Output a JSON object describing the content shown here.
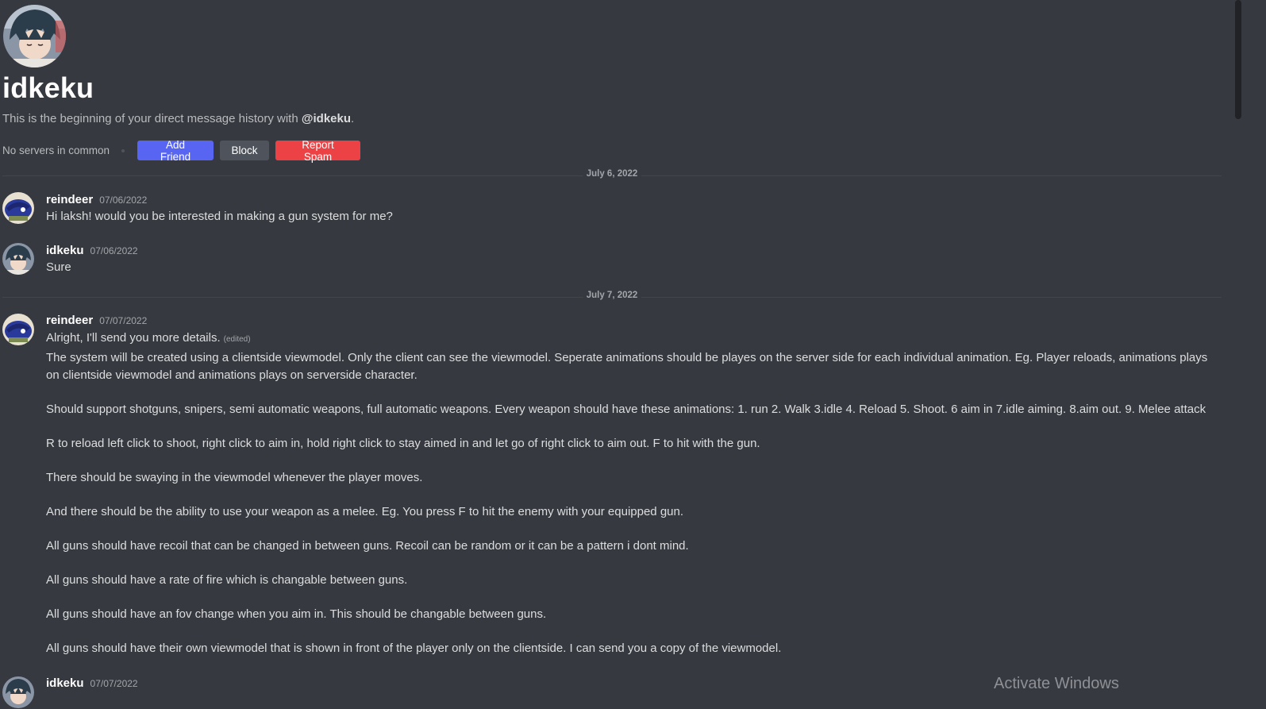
{
  "profile": {
    "name": "idkeku",
    "intro_prefix": "This is the beginning of your direct message history with ",
    "intro_handle": "@idkeku",
    "intro_suffix": ".",
    "servers_text": "No servers in common"
  },
  "actions": {
    "add_friend": "Add Friend",
    "block": "Block",
    "report_spam": "Report Spam"
  },
  "dividers": {
    "first": "July 6, 2022",
    "second": "July 7, 2022"
  },
  "messages": [
    {
      "author": "reindeer",
      "timestamp": "07/06/2022",
      "text": "Hi laksh! would you be interested in making a gun system for me?"
    },
    {
      "author": "idkeku",
      "timestamp": "07/06/2022",
      "text": "Sure"
    },
    {
      "author": "reindeer",
      "timestamp": "07/07/2022",
      "text": "Alright, I'll send you more details.",
      "edited_label": "(edited)",
      "paragraphs": [
        "The system will be created using a clientside viewmodel. Only the client can see the viewmodel. Seperate animations should be playes on the server side for each individual animation. Eg. Player reloads, animations plays on clientside viewmodel and animations plays on serverside character.",
        "Should support shotguns, snipers, semi automatic weapons, full automatic weapons. Every weapon should have these animations: 1. run 2. Walk 3.idle 4. Reload 5. Shoot. 6 aim in 7.idle aiming. 8.aim out. 9. Melee attack",
        "R to reload left click to shoot, right click to aim in, hold right click to stay aimed in and let go of right click to aim out. F to hit with the gun.",
        "There should be swaying in the viewmodel whenever the player moves.",
        "And there should be the ability to use your weapon as a melee. Eg. You press F to hit the enemy with your equipped gun.",
        "All guns should have recoil that can be changed in between guns. Recoil can be random or it can be a pattern i dont mind.",
        "All guns should have a rate of fire which is changable between guns.",
        "All guns should have an fov change when you aim in. This should be changable between guns.",
        "All guns should have their own viewmodel that is shown in front of the player only on the clientside. I can send you a copy of the viewmodel."
      ]
    },
    {
      "author": "idkeku",
      "timestamp": "07/07/2022"
    }
  ],
  "watermark": "Activate Windows",
  "colors": {
    "background": "#36393f",
    "blurple": "#5865f2",
    "danger": "#ed4245",
    "secondary": "#4f545c"
  }
}
